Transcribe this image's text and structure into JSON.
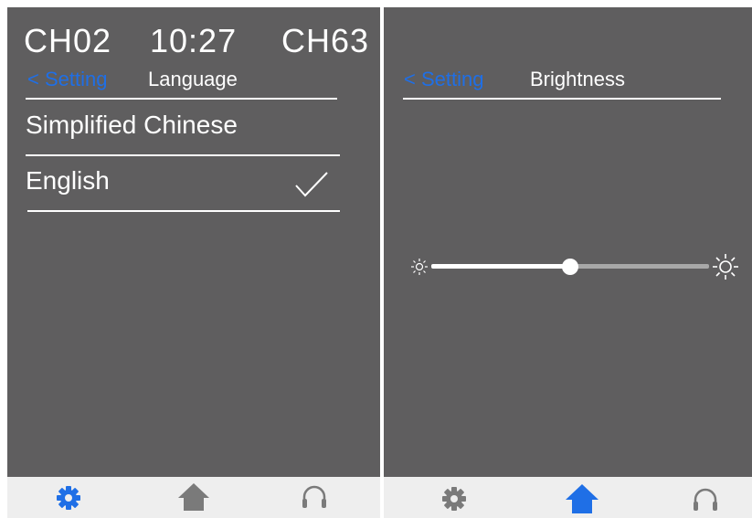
{
  "left_screen": {
    "status": {
      "channel_left": "CH02",
      "time": "10:27",
      "channel_right": "CH63"
    },
    "header": {
      "back_label": "< Setting",
      "title": "Language"
    },
    "languages": [
      {
        "label": "Simplified Chinese",
        "selected": false
      },
      {
        "label": "English",
        "selected": true
      }
    ],
    "nav": {
      "active": "settings-icon"
    }
  },
  "right_screen": {
    "header": {
      "back_label": "< Setting",
      "title": "Brightness"
    },
    "brightness": {
      "level": 0.5
    },
    "nav": {
      "active": "home-icon"
    }
  },
  "colors": {
    "accent": "#1f6fe6",
    "background": "#5f5e5f",
    "nav_background": "#eeeeee",
    "nav_inactive": "#7a7a7a"
  },
  "icons": [
    "settings-icon",
    "home-icon",
    "headphones-icon",
    "checkmark-icon",
    "brightness-low-icon",
    "brightness-high-icon"
  ]
}
